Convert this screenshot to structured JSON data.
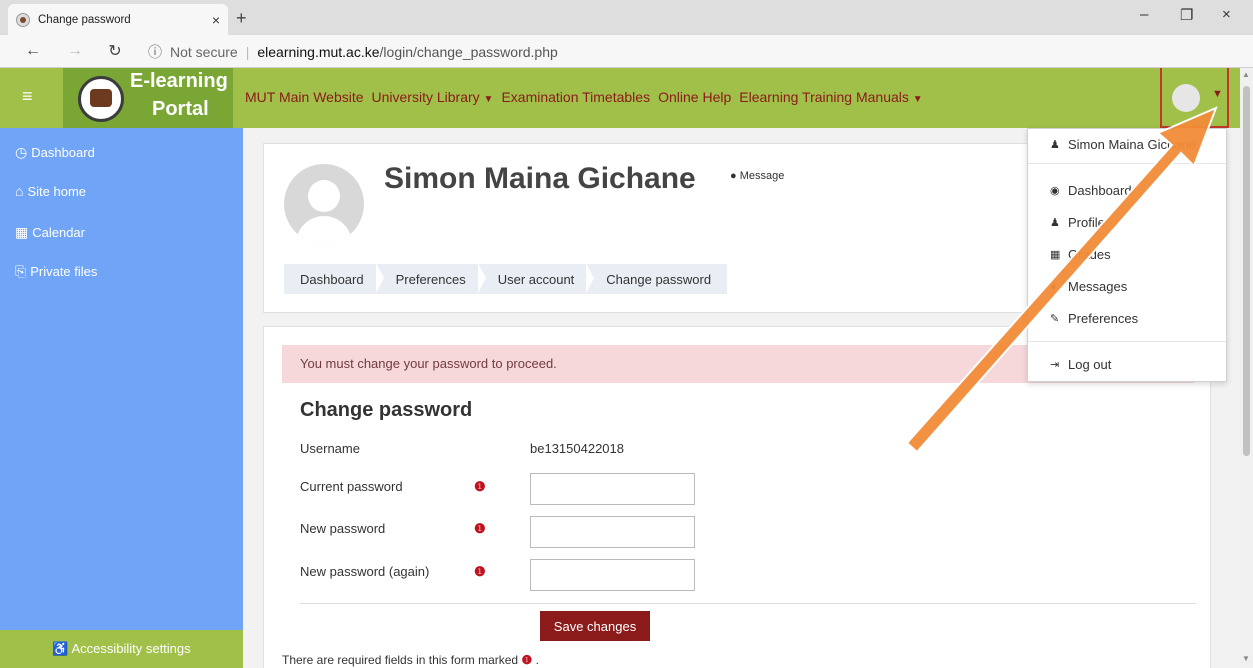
{
  "browser": {
    "tab_title": "Change password",
    "tab_close": "×",
    "new_tab": "+",
    "win_min": "–",
    "win_max": "❐",
    "win_close": "×",
    "not_secure": "Not secure",
    "url_host": "elearning.mut.ac.ke",
    "url_path": "/login/change_password.php",
    "more": "···"
  },
  "header": {
    "brand_line1": "E-learning",
    "brand_line2": "Portal",
    "nav": [
      {
        "label": "MUT Main Website"
      },
      {
        "label": "University Library"
      },
      {
        "label": "Examination Timetables"
      },
      {
        "label": "Online Help"
      },
      {
        "label": "Elearning Training Manuals"
      }
    ]
  },
  "sidebar": {
    "items": [
      {
        "label": "Dashboard",
        "icon": "dashboard-icon"
      },
      {
        "label": "Site home",
        "icon": "home-icon"
      },
      {
        "label": "Calendar",
        "icon": "calendar-icon"
      },
      {
        "label": "Private files",
        "icon": "files-icon"
      }
    ],
    "accessibility": "Accessibility settings"
  },
  "profile": {
    "name": "Simon Maina Gichane",
    "message_label": "Message"
  },
  "breadcrumb": [
    "Dashboard",
    "Preferences",
    "User account",
    "Change password"
  ],
  "form": {
    "alert": "You must change your password to proceed.",
    "heading": "Change password",
    "username_label": "Username",
    "username_value": "be13150422018",
    "current_label": "Current password",
    "new_label": "New password",
    "again_label": "New password (again)",
    "save_label": "Save changes",
    "required_note": "There are required fields in this form marked",
    "required_note_end": "."
  },
  "dropdown": {
    "items": [
      {
        "label": "Simon Maina Gichane",
        "icon": "user-icon"
      },
      {
        "label": "Dashboard",
        "icon": "dashboard-icon"
      },
      {
        "label": "Profile",
        "icon": "user-icon"
      },
      {
        "label": "Grades",
        "icon": "grid-icon"
      },
      {
        "label": "Messages",
        "icon": "chat-icon"
      },
      {
        "label": "Preferences",
        "icon": "wrench-icon"
      },
      {
        "label": "Log out",
        "icon": "logout-icon"
      }
    ]
  },
  "colors": {
    "header_green": "#a0c04a",
    "sidebar_blue": "#6fa4f7",
    "brand_red": "#8b1a1a",
    "alert_pink": "#f6d8db",
    "arrow_orange": "#f28c38"
  }
}
